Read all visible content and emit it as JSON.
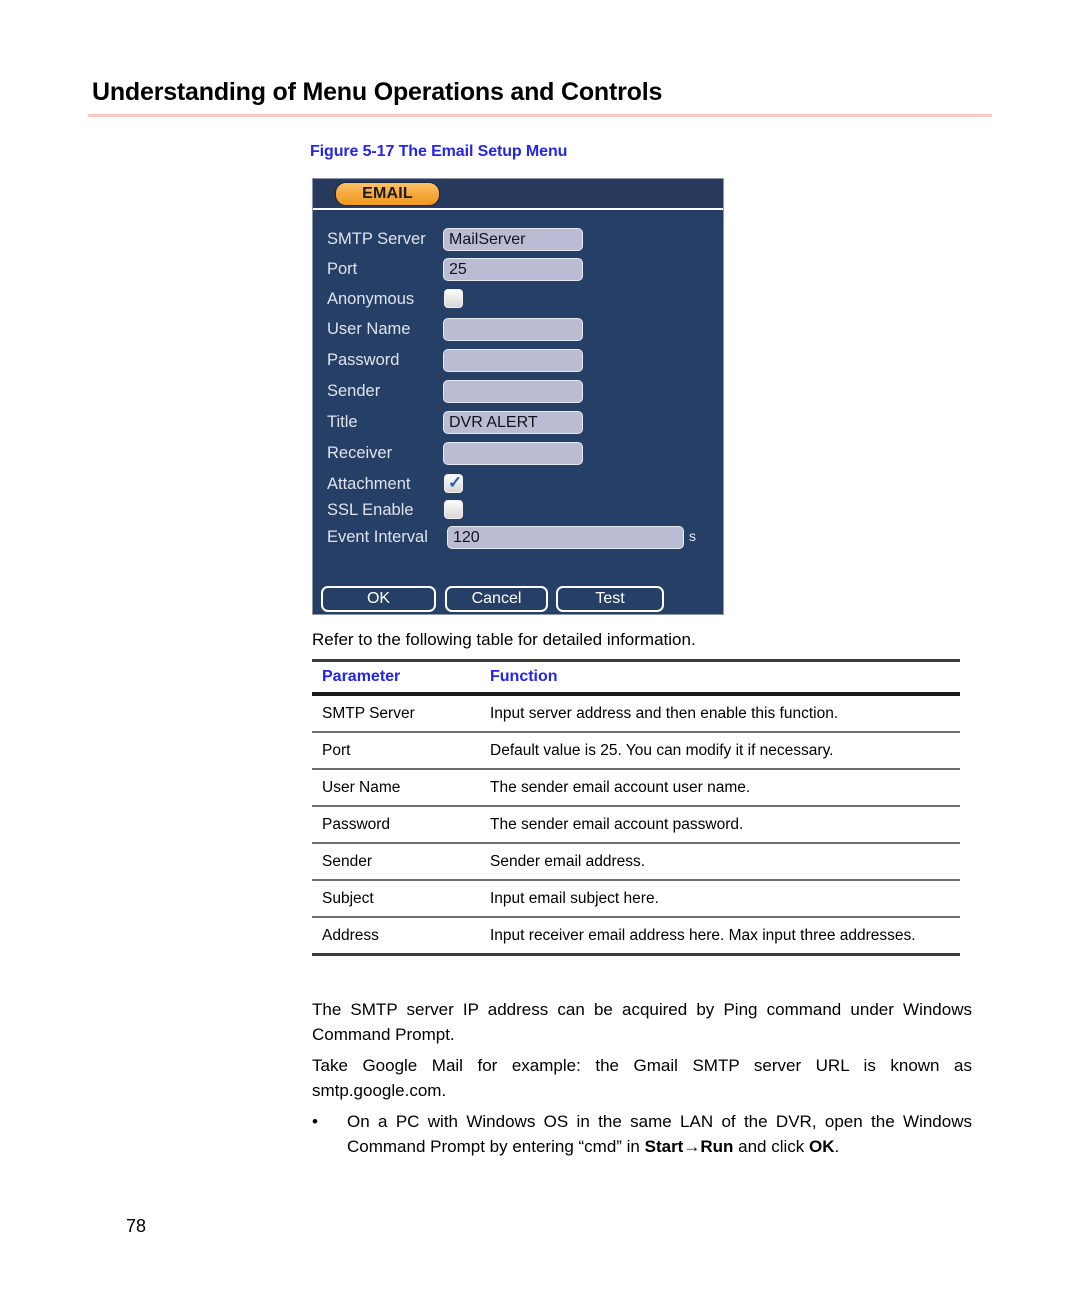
{
  "page": {
    "heading": "Understanding of Menu Operations and Controls",
    "number": "78"
  },
  "figure": {
    "caption": "Figure 5-17 The Email Setup Menu"
  },
  "dialog": {
    "tab_label": "EMAIL",
    "fields": [
      {
        "label": "SMTP Server",
        "type": "text",
        "value": "MailServer"
      },
      {
        "label": "Port",
        "type": "text",
        "value": "25"
      },
      {
        "label": "Anonymous",
        "type": "checkbox",
        "checked": false
      },
      {
        "label": "User Name",
        "type": "text",
        "value": ""
      },
      {
        "label": "Password",
        "type": "text",
        "value": ""
      },
      {
        "label": "Sender",
        "type": "text",
        "value": ""
      },
      {
        "label": "Title",
        "type": "text",
        "value": "DVR ALERT"
      },
      {
        "label": "Receiver",
        "type": "text",
        "value": ""
      },
      {
        "label": "Attachment",
        "type": "checkbox",
        "checked": true
      },
      {
        "label": "SSL Enable",
        "type": "checkbox",
        "checked": false
      },
      {
        "label": "Event Interval",
        "type": "text",
        "value": "120",
        "unit": "s"
      }
    ],
    "checkmark_glyph": "✓",
    "buttons": {
      "ok": "OK",
      "cancel": "Cancel",
      "test": "Test"
    },
    "colors": {
      "dialog_background": "#253f66",
      "tab_accent": "#f6a93c",
      "input_background": "#b9bcd3",
      "label_text": "#dfe3ee"
    }
  },
  "refer_text": "Refer to the following table for detailed information.",
  "table": {
    "headers": {
      "parameter": "Parameter",
      "function": "Function"
    },
    "header_color": "#2424ef",
    "rows": [
      {
        "parameter": "SMTP Server",
        "function": "Input server address and then enable this function."
      },
      {
        "parameter": "Port",
        "function": "Default value is 25. You can modify it if necessary."
      },
      {
        "parameter": "User Name",
        "function": "The sender email account user name."
      },
      {
        "parameter": "Password",
        "function": "The sender email account password."
      },
      {
        "parameter": "Sender",
        "function": "Sender email address."
      },
      {
        "parameter": "Subject",
        "function": "Input email subject here."
      },
      {
        "parameter": "Address",
        "function": "Input receiver email address here. Max input three addresses."
      }
    ]
  },
  "notes": {
    "note_1": "The SMTP server IP address can be acquired by Ping command under Windows Command Prompt.",
    "note_2": "Take Google Mail for example: the Gmail SMTP server URL is known as smtp.google.com.",
    "bullet_marker": "•",
    "bullet_part_1": "On a PC with Windows OS in the same LAN of the DVR, open the Windows Command Prompt by entering “cmd” in ",
    "bullet_bold_1": "Start→Run",
    "bullet_part_2": " and click ",
    "bullet_bold_2": "OK",
    "bullet_part_3": "."
  }
}
